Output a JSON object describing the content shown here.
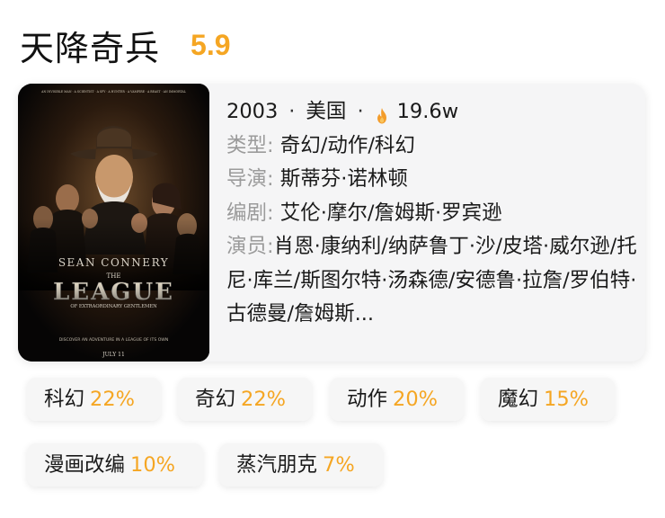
{
  "movie": {
    "title": "天降奇兵",
    "score": "5.9",
    "year": "2003",
    "country": "美国",
    "heat": "19.6w",
    "heat_icon": "fire-icon",
    "accent_color": "#f5a623"
  },
  "details": {
    "genre_label": "类型:",
    "genre_value": "奇幻/动作/科幻",
    "director_label": "导演:",
    "director_value": "斯蒂芬·诺林顿",
    "writer_label": "编剧:",
    "writer_value": "艾伦·摩尔/詹姆斯·罗宾逊",
    "cast_label": "演员:",
    "cast_value": "肖恩·康纳利/纳萨鲁丁·沙/皮塔·威尔逊/托尼·库兰/斯图尔特·汤森德/安德鲁·拉詹/罗伯特·古德曼/詹姆斯..."
  },
  "poster": {
    "tagline_top": "AN INVISIBLE MAN · A SCIENTIST · A SPY · A HUNTER · A VAMPIRE · A BEAST · AN IMMORTAL",
    "actor": "SEAN CONNERY",
    "title_small": "THE",
    "title_big": "LEAGUE",
    "subtitle": "OF EXTRAORDINARY GENTLEMEN",
    "tagline_bottom": "DISCOVER AN ADVENTURE IN A LEAGUE OF ITS OWN",
    "date": "JULY 11"
  },
  "tags": [
    {
      "name": "科幻",
      "pct": "22%"
    },
    {
      "name": "奇幻",
      "pct": "22%"
    },
    {
      "name": "动作",
      "pct": "20%"
    },
    {
      "name": "魔幻",
      "pct": "15%"
    },
    {
      "name": "漫画改编",
      "pct": "10%"
    },
    {
      "name": "蒸汽朋克",
      "pct": "7%"
    }
  ]
}
